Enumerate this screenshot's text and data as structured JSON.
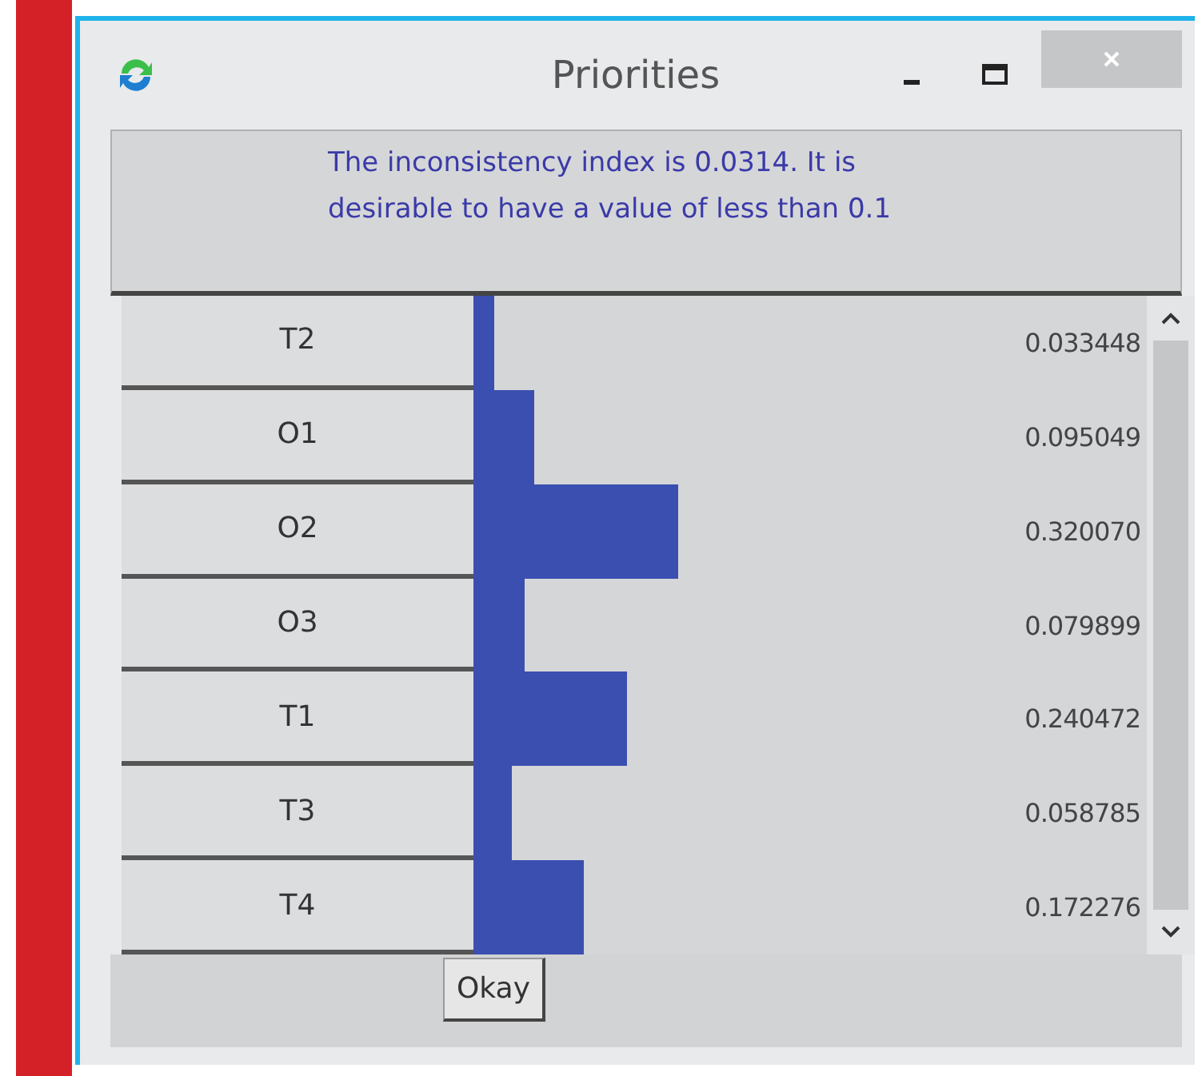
{
  "window": {
    "title": "Priorities"
  },
  "message": "The inconsistency index is 0.0314.  It is desirable to have a value of less than 0.1",
  "rows": [
    {
      "label": "T2",
      "value": "0.033448"
    },
    {
      "label": "O1",
      "value": "0.095049"
    },
    {
      "label": "O2",
      "value": "0.320070"
    },
    {
      "label": "O3",
      "value": "0.079899"
    },
    {
      "label": "T1",
      "value": "0.240472"
    },
    {
      "label": "T3",
      "value": "0.058785"
    },
    {
      "label": "T4",
      "value": "0.172276"
    }
  ],
  "buttons": [
    "Okay"
  ]
}
